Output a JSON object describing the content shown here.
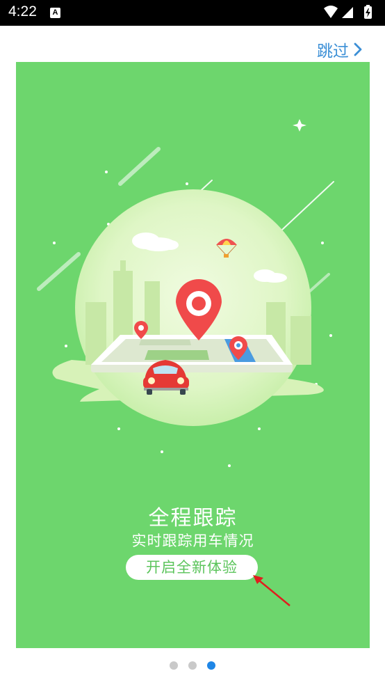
{
  "status_bar": {
    "time": "4:22",
    "notification_icon": "A"
  },
  "header": {
    "skip_label": "跳过"
  },
  "slide": {
    "title": "全程跟踪",
    "subtitle": "实时跟踪用车情况",
    "cta_label": "开启全新体验"
  },
  "pager": {
    "count": 3,
    "active_index": 2
  },
  "colors": {
    "slide_bg": "#6dd66d",
    "accent_blue": "#3b8fd6",
    "active_dot": "#1f86e6",
    "pin_red": "#f04a4a"
  }
}
